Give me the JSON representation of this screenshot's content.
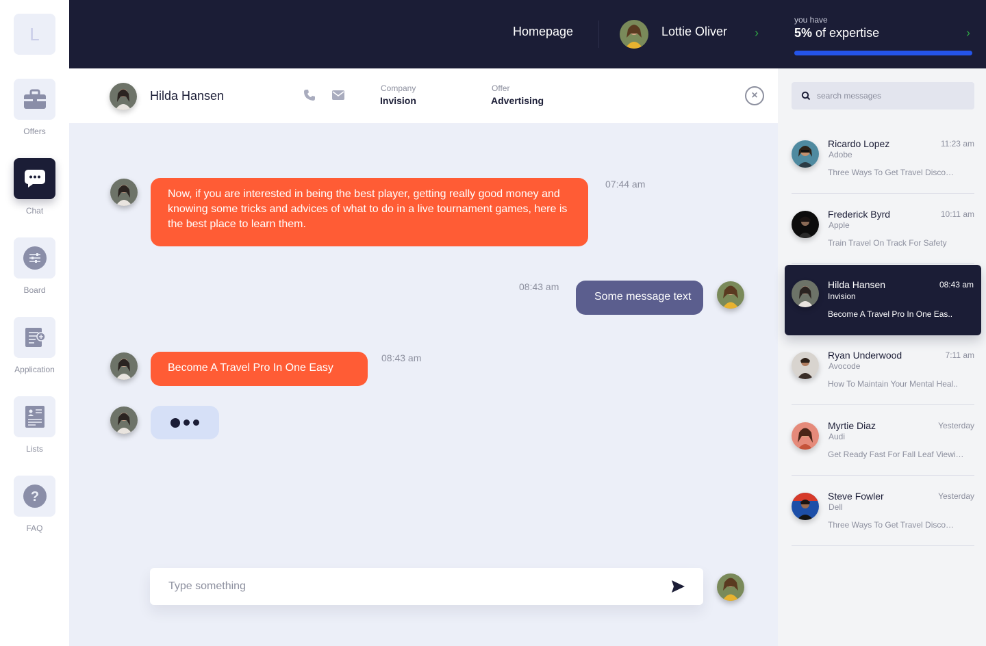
{
  "sidebar": {
    "logo": "L",
    "items": [
      {
        "label": "Offers",
        "icon": "briefcase-icon"
      },
      {
        "label": "Chat",
        "icon": "chat-bubble-icon",
        "active": true
      },
      {
        "label": "Board",
        "icon": "sliders-icon"
      },
      {
        "label": "Application",
        "icon": "document-add-icon"
      },
      {
        "label": "Lists",
        "icon": "list-card-icon"
      },
      {
        "label": "FAQ",
        "icon": "question-icon"
      }
    ]
  },
  "header": {
    "homepage_label": "Homepage",
    "user_name": "Lottie Oliver"
  },
  "expertise": {
    "you_have": "you have",
    "percent": "5%",
    "suffix": "of expertise",
    "progress_value": 1.0
  },
  "contact": {
    "name": "Hilda Hansen",
    "company_label": "Company",
    "company": "Invision",
    "offer_label": "Offer",
    "offer": "Advertising"
  },
  "messages": [
    {
      "text": "Now, if you are interested in being the best player, getting really good money and knowing some tricks and advices of what to do in a live tournament games, here is the best place to learn them.",
      "time": "07:44 am",
      "from": "contact"
    },
    {
      "text": "Some message text",
      "time": "08:43 am",
      "from": "me"
    },
    {
      "text": "Become A Travel Pro In One Easy",
      "time": "08:43 am",
      "from": "contact"
    }
  ],
  "composer": {
    "placeholder": "Type something"
  },
  "search": {
    "placeholder": "search messages"
  },
  "conversations": [
    {
      "name": "Ricardo Lopez",
      "company": "Adobe",
      "preview": "Three Ways To Get Travel Disco…",
      "time": "11:23 am"
    },
    {
      "name": "Frederick Byrd",
      "company": "Apple",
      "preview": "Train Travel On Track For Safety",
      "time": "10:11 am"
    },
    {
      "name": "Hilda Hansen",
      "company": "Invision",
      "preview": "Become A Travel Pro In One Eas..",
      "time": "08:43 am",
      "active": true
    },
    {
      "name": "Ryan Underwood",
      "company": "Avocode",
      "preview": "How To Maintain Your Mental Heal..",
      "time": "7:11 am"
    },
    {
      "name": "Myrtie Diaz",
      "company": "Audi",
      "preview": "Get Ready Fast For Fall Leaf Viewi…",
      "time": "Yesterday"
    },
    {
      "name": "Steve Fowler",
      "company": "Dell",
      "preview": "Three Ways To Get Travel Disco…",
      "time": "Yesterday"
    }
  ],
  "colors": {
    "dark": "#1b1d36",
    "accent_orange": "#ff5c35",
    "accent_purple": "#5b5e8e",
    "progress_blue": "#2454ea",
    "chevron_green": "#2ea043"
  }
}
